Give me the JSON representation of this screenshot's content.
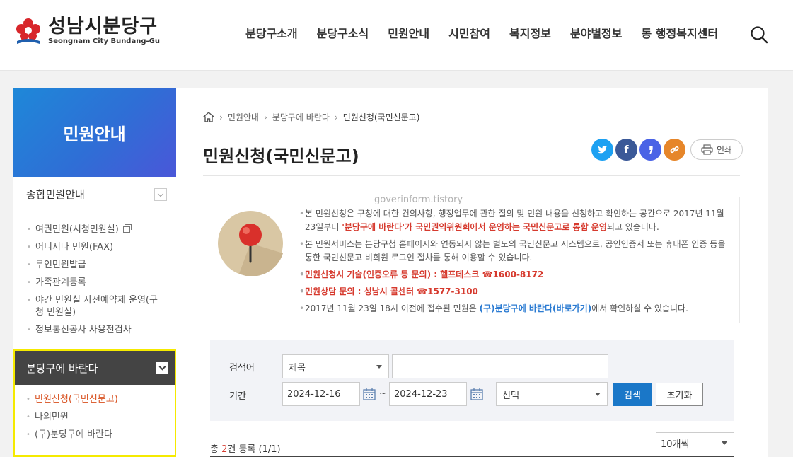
{
  "header": {
    "logo_ko": "성남시분당구",
    "logo_en": "Seongnam City Bundang-Gu",
    "nav": [
      "분당구소개",
      "분당구소식",
      "민원안내",
      "시민참여",
      "복지정보",
      "분야별정보",
      "동 행정복지센터"
    ]
  },
  "sidebar": {
    "title": "민원안내",
    "group1": {
      "label": "종합민원안내",
      "items": [
        "여권민원(시청민원실)",
        "어디서나 민원(FAX)",
        "무인민원발급",
        "가족관계등록",
        "야간 민원실 사전예약제 운영(구청 민원실)",
        "정보통신공사 사용전검사"
      ]
    },
    "group2": {
      "label": "분당구에 바란다",
      "items": [
        "민원신청(국민신문고)",
        "나의민원",
        "(구)분당구에 바란다"
      ]
    }
  },
  "breadcrumb": [
    "민원안내",
    "분당구에 바란다",
    "민원신청(국민신문고)"
  ],
  "page_title": "민원신청(국민신문고)",
  "share": {
    "print_label": "인쇄",
    "colors": {
      "twitter": "#1da1f2",
      "facebook": "#3b5998",
      "story": "#4a63e6",
      "link": "#e6862a"
    }
  },
  "watermark": "goverinform.tistory",
  "info": {
    "line1_a": "본 민원신청은 구청에 대한 건의사항, 행정업무에 관한 질의 및 민원 내용을 신청하고 확인하는 공간으로 2017년 11월 23일부터 ",
    "line1_b": "'분당구에 바란다'가 국민권익위원회에서 운영하는 국민신문고로 통합 운영",
    "line1_c": "되고 있습니다.",
    "line2": "본 민원서비스는 분당구청 홈페이지와 연동되지 않는 별도의 국민신문고 시스템으로, 공인인증서 또는 휴대폰 인증 등을 통한 국민신문고 비회원 로그인 절차를 통해 이용할 수 있습니다.",
    "line3": "민원신청시 기술(인증오류 등 문의) : 헬프데스크 ☎1600-8172",
    "line4": "민원상담 문의 : 성남시 콜센터 ☎1577-3100",
    "line5_a": "2017년 11월 23일 18시 이전에 접수된 민원은 ",
    "line5_b": "(구)분당구에 바란다(바로가기)",
    "line5_c": "에서 확인하실 수 있습니다."
  },
  "search": {
    "label_keyword": "검색어",
    "field_select": "제목",
    "keyword_value": "",
    "label_period": "기간",
    "date_from": "2024-12-16",
    "tilde": "~",
    "date_to": "2024-12-23",
    "status_select": "선택",
    "search_button": "검색",
    "reset_button": "초기화"
  },
  "list": {
    "total_prefix": "총 ",
    "total_count": "2",
    "total_suffix": "건 등록 (1/1)",
    "per_page": "10개씩"
  }
}
